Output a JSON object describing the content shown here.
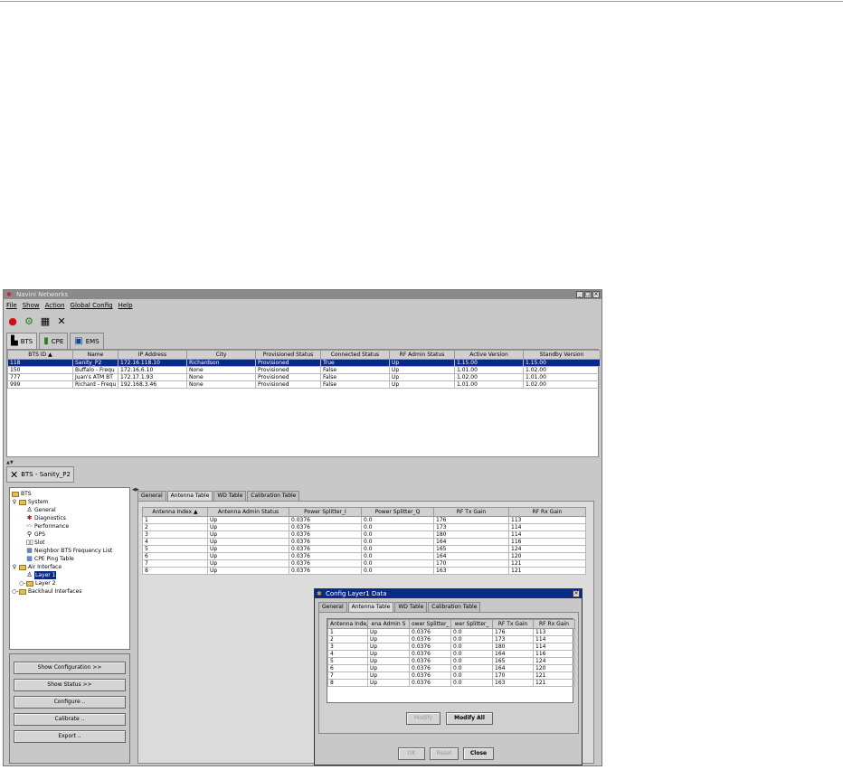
{
  "window": {
    "title": "Navini Networks",
    "min": "_",
    "max": "□",
    "close": "×"
  },
  "menu": [
    "File",
    "Show",
    "Action",
    "Global Config",
    "Help"
  ],
  "toolbar_icons": [
    "alarm-icon",
    "network-icon",
    "grid-icon",
    "tools-icon"
  ],
  "top_tabs": [
    {
      "label": "BTS",
      "icon": "bts-icon"
    },
    {
      "label": "CPE",
      "icon": "cpe-icon"
    },
    {
      "label": "EMS",
      "icon": "ems-icon"
    }
  ],
  "bts_table": {
    "columns": [
      "BTS ID",
      "Name",
      "IP Address",
      "City",
      "Provisioned Status",
      "Connected Status",
      "RF Admin Status",
      "Active Version",
      "Standby Version"
    ],
    "sort_marker": "▲",
    "rows": [
      [
        "118",
        "Sanity_P2",
        "172.16.118.10",
        "Richardson",
        "Provisioned",
        "True",
        "Up",
        "1.15.00",
        "1.15.00"
      ],
      [
        "150",
        "Buffalo - Frequ",
        "172.16.6.10",
        "None",
        "Provisioned",
        "False",
        "Up",
        "1.01.00",
        "1.02.00"
      ],
      [
        "777",
        "Juan's ATM BT",
        "172.17.1.93",
        "None",
        "Provisioned",
        "False",
        "Up",
        "1.02.00",
        "1.01.00"
      ],
      [
        "999",
        "Richard - Frequ",
        "192.168.3.46",
        "None",
        "Provisioned",
        "False",
        "Up",
        "1.01.00",
        "1.02.00"
      ]
    ]
  },
  "bts_tab": {
    "label": "BTS - Sanity_P2"
  },
  "tree": [
    {
      "label": "BTS",
      "type": "folder",
      "indent": 0
    },
    {
      "label": "System",
      "type": "folder",
      "indent": 1
    },
    {
      "label": "General",
      "type": "leaf",
      "indent": 2
    },
    {
      "label": "Diagnostics",
      "type": "leaf",
      "indent": 2
    },
    {
      "label": "Performance",
      "type": "leaf",
      "indent": 2
    },
    {
      "label": "GPS",
      "type": "leaf",
      "indent": 2
    },
    {
      "label": "Slot",
      "type": "leaf",
      "indent": 2
    },
    {
      "label": "Neighbor BTS Frequency List",
      "type": "leaf",
      "indent": 2
    },
    {
      "label": "CPE Ping Table",
      "type": "leaf",
      "indent": 2
    },
    {
      "label": "Air Interface",
      "type": "folder",
      "indent": 1
    },
    {
      "label": "Layer 1",
      "type": "leaf",
      "indent": 2,
      "selected": true
    },
    {
      "label": "Layer 2",
      "type": "folder",
      "indent": 2
    },
    {
      "label": "Backhaul Interfaces",
      "type": "folder",
      "indent": 1
    }
  ],
  "left_buttons": [
    "Show Configuration >>",
    "Show Status >>",
    "Configure ..",
    "Calibrate ..",
    "Export .."
  ],
  "right_tabs": [
    "General",
    "Antenna Table",
    "WD Table",
    "Calibration Table"
  ],
  "antenna_table": {
    "columns": [
      "Antenna Index",
      "Antenna Admin Status",
      "Power Splitter_I",
      "Power Splitter_Q",
      "RF Tx Gain",
      "RF Rx Gain"
    ],
    "sort_marker": "▲",
    "rows": [
      [
        "1",
        "Up",
        "0.0376",
        "0.0",
        "176",
        "113"
      ],
      [
        "2",
        "Up",
        "0.0376",
        "0.0",
        "173",
        "114"
      ],
      [
        "3",
        "Up",
        "0.0376",
        "0.0",
        "180",
        "114"
      ],
      [
        "4",
        "Up",
        "0.0376",
        "0.0",
        "164",
        "116"
      ],
      [
        "5",
        "Up",
        "0.0376",
        "0.0",
        "165",
        "124"
      ],
      [
        "6",
        "Up",
        "0.0376",
        "0.0",
        "164",
        "120"
      ],
      [
        "7",
        "Up",
        "0.0376",
        "0.0",
        "170",
        "121"
      ],
      [
        "8",
        "Up",
        "0.0376",
        "0.0",
        "163",
        "121"
      ]
    ]
  },
  "dialog": {
    "title": "Config Layer1 Data",
    "close": "×",
    "tabs": [
      "General",
      "Antenna Table",
      "WD Table",
      "Calibration Table"
    ],
    "columns": [
      "Antenna Inde",
      "ena Admin S",
      "ower Splitter_",
      "wer Splitter_",
      "RF Tx Gain",
      "RF Rx Gain"
    ],
    "sort_marker": "▲",
    "rows": [
      [
        "1",
        "Up",
        "0.0376",
        "0.0",
        "176",
        "113"
      ],
      [
        "2",
        "Up",
        "0.0376",
        "0.0",
        "173",
        "114"
      ],
      [
        "3",
        "Up",
        "0.0376",
        "0.0",
        "180",
        "114"
      ],
      [
        "4",
        "Up",
        "0.0376",
        "0.0",
        "164",
        "116"
      ],
      [
        "5",
        "Up",
        "0.0376",
        "0.0",
        "165",
        "124"
      ],
      [
        "6",
        "Up",
        "0.0376",
        "0.0",
        "164",
        "120"
      ],
      [
        "7",
        "Up",
        "0.0376",
        "0.0",
        "170",
        "121"
      ],
      [
        "8",
        "Up",
        "0.0376",
        "0.0",
        "163",
        "121"
      ]
    ],
    "modify": "Modify",
    "modify_all": "Modify All",
    "ok": "OK",
    "reset": "Reset",
    "close_btn": "Close"
  },
  "colors": {
    "selection": "#0a2a8a",
    "window_bg": "#c8c8c8",
    "title_bg": "#8a8a8a"
  }
}
